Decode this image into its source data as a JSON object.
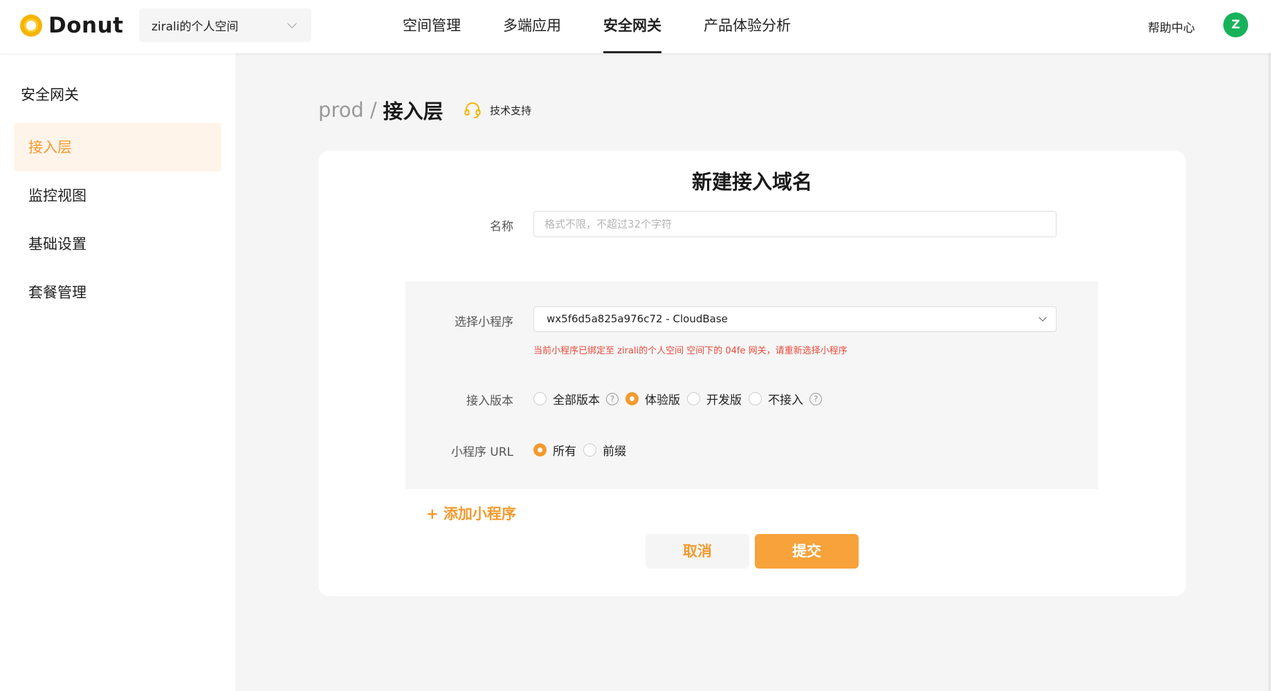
{
  "header": {
    "brand": "Donut",
    "space_selector": "zirali的个人空间",
    "nav": [
      {
        "label": "空间管理",
        "active": false
      },
      {
        "label": "多端应用",
        "active": false
      },
      {
        "label": "安全网关",
        "active": true
      },
      {
        "label": "产品体验分析",
        "active": false
      }
    ],
    "help": "帮助中心",
    "avatar_letter": "Z"
  },
  "sidebar": {
    "title": "安全网关",
    "items": [
      {
        "label": "接入层",
        "active": true
      },
      {
        "label": "监控视图",
        "active": false
      },
      {
        "label": "基础设置",
        "active": false
      },
      {
        "label": "套餐管理",
        "active": false
      }
    ]
  },
  "breadcrumb": {
    "env": "prod",
    "separator": "/",
    "page": "接入层",
    "support": "技术支持"
  },
  "form": {
    "title": "新建接入域名",
    "name_label": "名称",
    "name_placeholder": "格式不限，不超过32个字符",
    "name_value": "",
    "miniprogram_label": "选择小程序",
    "miniprogram_value": "wx5f6d5a825a976c72 - CloudBase",
    "miniprogram_error": "当前小程序已绑定至 zirali的个人空间 空间下的 04fe 网关，请重新选择小程序",
    "version_label": "接入版本",
    "version_options": [
      {
        "label": "全部版本",
        "selected": false,
        "help": true
      },
      {
        "label": "体验版",
        "selected": true,
        "help": false
      },
      {
        "label": "开发版",
        "selected": false,
        "help": false
      },
      {
        "label": "不接入",
        "selected": false,
        "help": true
      }
    ],
    "url_label": "小程序 URL",
    "url_options": [
      {
        "label": "所有",
        "selected": true
      },
      {
        "label": "前缀",
        "selected": false
      }
    ],
    "add_miniprogram": "+ 添加小程序",
    "cancel": "取消",
    "submit": "提交",
    "help_glyph": "?"
  },
  "colors": {
    "accent": "#f39a2d",
    "error": "#e84a3b",
    "avatar": "#17b35a"
  }
}
